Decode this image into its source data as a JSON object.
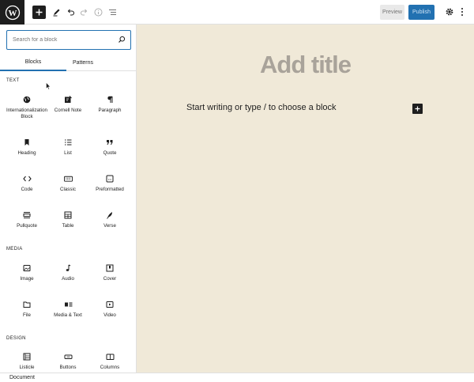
{
  "toolbar": {
    "logo_icon": "wordpress-logo-icon",
    "add_icon": "plus-icon",
    "tools_icon": "pencil-icon",
    "undo_icon": "undo-icon",
    "redo_icon": "redo-icon",
    "details_icon": "info-icon",
    "outline_icon": "list-view-icon",
    "preview_label": "Preview",
    "publish_label": "Publish",
    "settings_icon": "gear-icon",
    "more_icon": "more-vertical-icon",
    "accent": "#2271b1"
  },
  "inserter": {
    "search_placeholder": "Search for a block",
    "tabs": [
      {
        "label": "Blocks",
        "active": true
      },
      {
        "label": "Patterns",
        "active": false
      }
    ],
    "sections": [
      {
        "label": "TEXT",
        "blocks": [
          {
            "label": "Internationalization Block",
            "icon": "globe-icon"
          },
          {
            "label": "Cornell Note",
            "icon": "note-icon"
          },
          {
            "label": "Paragraph",
            "icon": "paragraph-icon"
          },
          {
            "label": "Heading",
            "icon": "bookmark-icon"
          },
          {
            "label": "List",
            "icon": "list-icon"
          },
          {
            "label": "Quote",
            "icon": "quote-icon"
          },
          {
            "label": "Code",
            "icon": "code-icon"
          },
          {
            "label": "Classic",
            "icon": "keyboard-icon"
          },
          {
            "label": "Preformatted",
            "icon": "preformatted-icon"
          },
          {
            "label": "Pullquote",
            "icon": "pullquote-icon"
          },
          {
            "label": "Table",
            "icon": "table-icon"
          },
          {
            "label": "Verse",
            "icon": "feather-icon"
          }
        ]
      },
      {
        "label": "MEDIA",
        "blocks": [
          {
            "label": "Image",
            "icon": "image-icon"
          },
          {
            "label": "Audio",
            "icon": "music-note-icon"
          },
          {
            "label": "Cover",
            "icon": "cover-icon"
          },
          {
            "label": "File",
            "icon": "folder-icon"
          },
          {
            "label": "Media & Text",
            "icon": "media-text-icon"
          },
          {
            "label": "Video",
            "icon": "video-icon"
          }
        ]
      },
      {
        "label": "DESIGN",
        "blocks": [
          {
            "label": "Listicle",
            "icon": "listicle-icon"
          },
          {
            "label": "Buttons",
            "icon": "buttons-icon"
          },
          {
            "label": "Columns",
            "icon": "columns-icon"
          }
        ]
      }
    ]
  },
  "editor": {
    "title_placeholder": "Add title",
    "paragraph_placeholder": "Start writing or type / to choose a block",
    "add_block_icon": "plus-icon"
  },
  "footer": {
    "breadcrumb": "Document"
  }
}
